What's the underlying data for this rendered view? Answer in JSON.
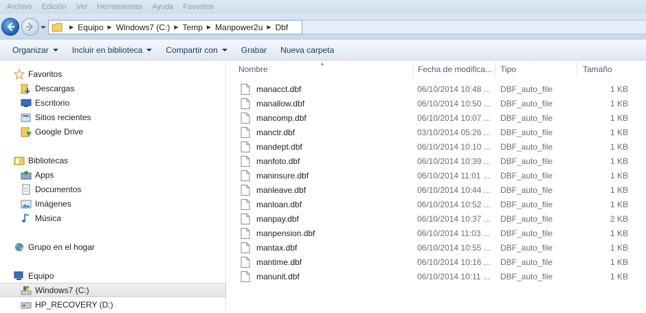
{
  "menubar": {
    "items": [
      "Archivo",
      "Edición",
      "Ver",
      "Herramientas",
      "Ayuda",
      "Favoritos"
    ]
  },
  "address": {
    "crumbs": [
      "Equipo",
      "Windows7 (C:)",
      "Temp",
      "Manpower2u",
      "Dbf"
    ]
  },
  "toolbar": {
    "organizar": "Organizar",
    "incluir": "Incluir en biblioteca",
    "compartir": "Compartir con",
    "grabar": "Grabar",
    "nueva_carpeta": "Nueva carpeta"
  },
  "nav": {
    "favoritos": "Favoritos",
    "descargas": "Descargas",
    "escritorio": "Escritorio",
    "sitios_recientes": "Sitios recientes",
    "google_drive": "Google Drive",
    "bibliotecas": "Bibliotecas",
    "apps": "Apps",
    "documentos": "Documentos",
    "imagenes": "Imágenes",
    "musica": "Música",
    "grupo_hogar": "Grupo en el hogar",
    "equipo": "Equipo",
    "windows7": "Windows7 (C:)",
    "hp_recovery": "HP_RECOVERY (D:)"
  },
  "columns": {
    "nombre": "Nombre",
    "fecha": "Fecha de modifica...",
    "tipo": "Tipo",
    "tamano": "Tamaño"
  },
  "files": [
    {
      "name": "manacct.dbf",
      "date": "06/10/2014 10:48 ...",
      "type": "DBF_auto_file",
      "size": "1 KB"
    },
    {
      "name": "manallow.dbf",
      "date": "06/10/2014 10:50 ...",
      "type": "DBF_auto_file",
      "size": "1 KB"
    },
    {
      "name": "mancomp.dbf",
      "date": "06/10/2014 10:07 ...",
      "type": "DBF_auto_file",
      "size": "1 KB"
    },
    {
      "name": "manctr.dbf",
      "date": "03/10/2014 05:26 ...",
      "type": "DBF_auto_file",
      "size": "1 KB"
    },
    {
      "name": "mandept.dbf",
      "date": "06/10/2014 10:10 ...",
      "type": "DBF_auto_file",
      "size": "1 KB"
    },
    {
      "name": "manfoto.dbf",
      "date": "06/10/2014 10:39 ...",
      "type": "DBF_auto_file",
      "size": "1 KB"
    },
    {
      "name": "maninsure.dbf",
      "date": "06/10/2014 11:01 ...",
      "type": "DBF_auto_file",
      "size": "1 KB"
    },
    {
      "name": "manleave.dbf",
      "date": "06/10/2014 10:44 ...",
      "type": "DBF_auto_file",
      "size": "1 KB"
    },
    {
      "name": "manloan.dbf",
      "date": "06/10/2014 10:52 ...",
      "type": "DBF_auto_file",
      "size": "1 KB"
    },
    {
      "name": "manpay.dbf",
      "date": "06/10/2014 10:37 ...",
      "type": "DBF_auto_file",
      "size": "2 KB"
    },
    {
      "name": "manpension.dbf",
      "date": "06/10/2014 11:03 ...",
      "type": "DBF_auto_file",
      "size": "1 KB"
    },
    {
      "name": "mantax.dbf",
      "date": "06/10/2014 10:55 ...",
      "type": "DBF_auto_file",
      "size": "1 KB"
    },
    {
      "name": "mantime.dbf",
      "date": "06/10/2014 10:16 ...",
      "type": "DBF_auto_file",
      "size": "1 KB"
    },
    {
      "name": "manunit.dbf",
      "date": "06/10/2014 10:11 ...",
      "type": "DBF_auto_file",
      "size": "1 KB"
    }
  ]
}
